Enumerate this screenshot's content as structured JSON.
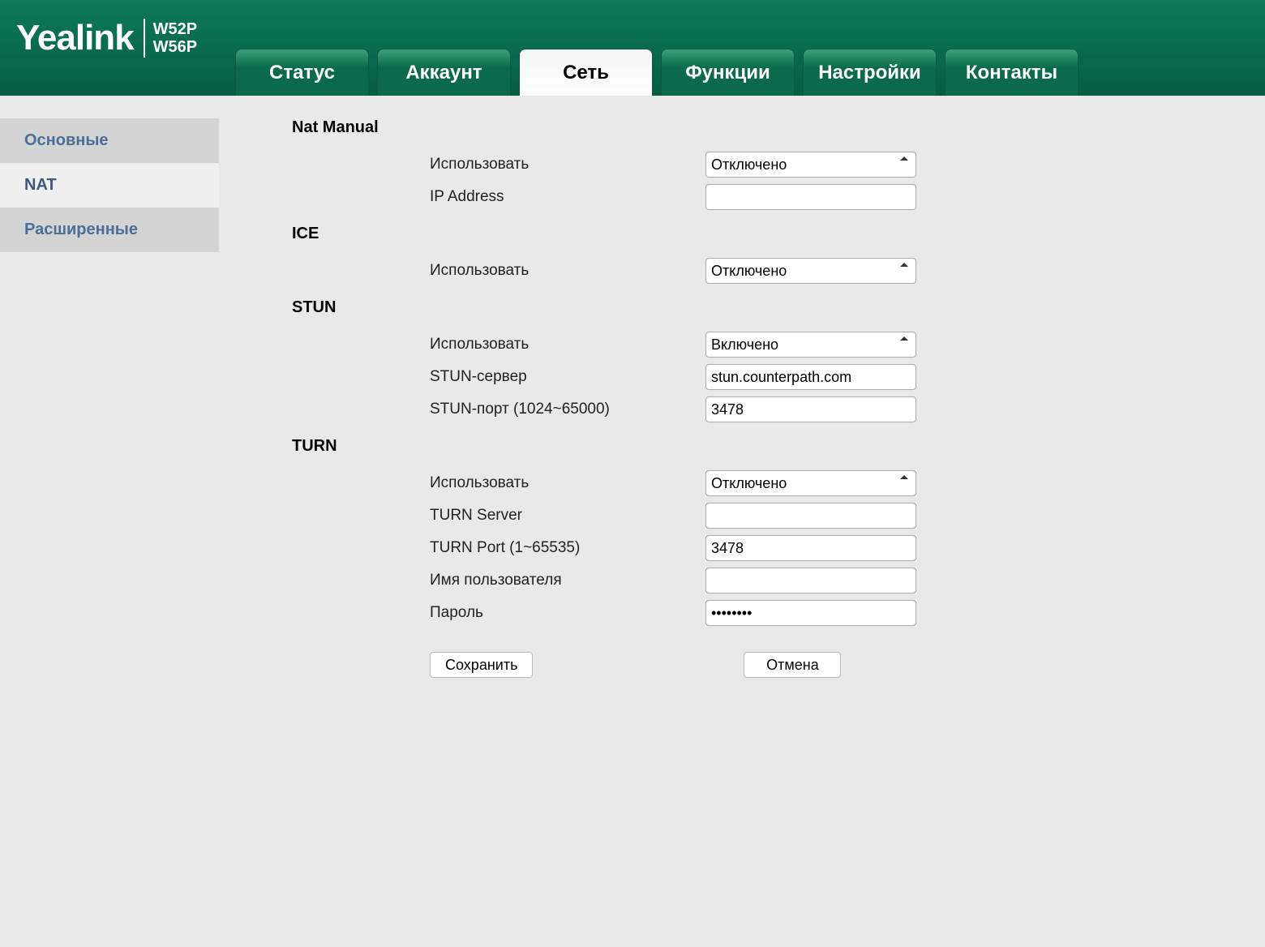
{
  "header": {
    "logo": "Yealink",
    "models": [
      "W52P",
      "W56P"
    ]
  },
  "tabs": [
    {
      "label": "Статус",
      "active": false
    },
    {
      "label": "Аккаунт",
      "active": false
    },
    {
      "label": "Сеть",
      "active": true
    },
    {
      "label": "Функции",
      "active": false
    },
    {
      "label": "Настройки",
      "active": false
    },
    {
      "label": "Контакты",
      "active": false
    }
  ],
  "sidebar": [
    {
      "label": "Основные",
      "active": false
    },
    {
      "label": "NAT",
      "active": true
    },
    {
      "label": "Расширенные",
      "active": false
    }
  ],
  "select_options": {
    "enable": [
      "Отключено",
      "Включено"
    ]
  },
  "sections": {
    "nat_manual": {
      "title": "Nat Manual",
      "use_label": "Использовать",
      "use_value": "Отключено",
      "ip_label": "IP Address",
      "ip_value": ""
    },
    "ice": {
      "title": "ICE",
      "use_label": "Использовать",
      "use_value": "Отключено"
    },
    "stun": {
      "title": "STUN",
      "use_label": "Использовать",
      "use_value": "Включено",
      "server_label": "STUN-сервер",
      "server_value": "stun.counterpath.com",
      "port_label": "STUN-порт (1024~65000)",
      "port_value": "3478"
    },
    "turn": {
      "title": "TURN",
      "use_label": "Использовать",
      "use_value": "Отключено",
      "server_label": "TURN Server",
      "server_value": "",
      "port_label": "TURN Port (1~65535)",
      "port_value": "3478",
      "user_label": "Имя пользователя",
      "user_value": "",
      "pass_label": "Пароль",
      "pass_value": "••••••••"
    }
  },
  "buttons": {
    "save": "Сохранить",
    "cancel": "Отмена"
  }
}
